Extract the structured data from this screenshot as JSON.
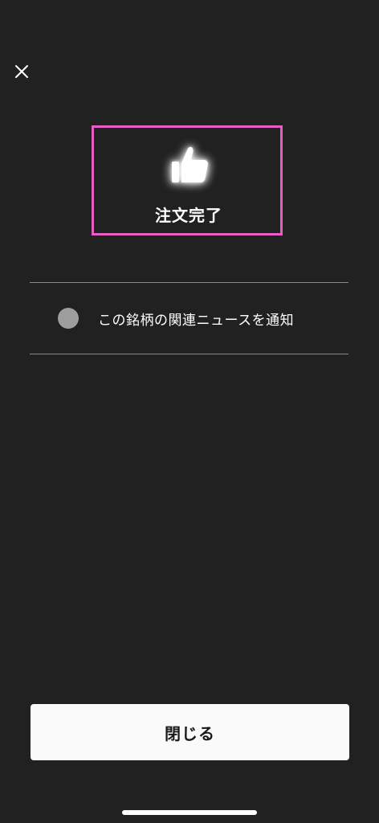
{
  "header": {
    "close_icon": "close-icon"
  },
  "result": {
    "icon": "thumbs-up-icon",
    "title": "注文完了",
    "highlight_color": "#e85cc6"
  },
  "notification": {
    "label": "この銘柄の関連ニュースを通知",
    "toggle_state": "off"
  },
  "footer": {
    "close_label": "閉じる"
  },
  "colors": {
    "background": "#212121",
    "button_background": "#fafafa",
    "divider": "#8a8a8a",
    "radio_off": "#9e9e9e"
  }
}
